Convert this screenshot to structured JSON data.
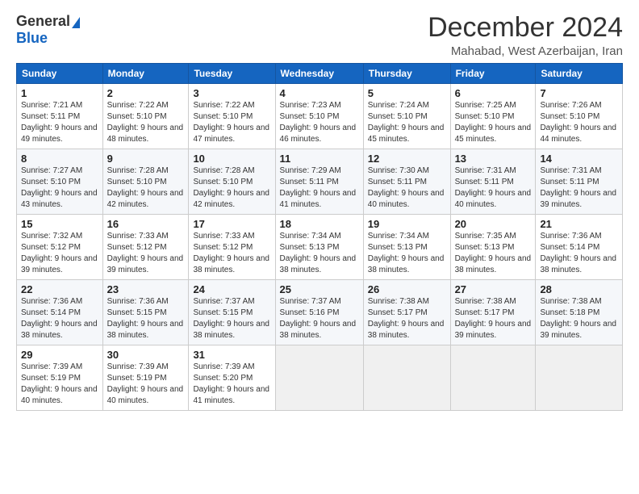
{
  "logo": {
    "general": "General",
    "blue": "Blue"
  },
  "title": "December 2024",
  "location": "Mahabad, West Azerbaijan, Iran",
  "days_header": [
    "Sunday",
    "Monday",
    "Tuesday",
    "Wednesday",
    "Thursday",
    "Friday",
    "Saturday"
  ],
  "weeks": [
    [
      {
        "day": "1",
        "sunrise": "7:21 AM",
        "sunset": "5:11 PM",
        "daylight": "9 hours and 49 minutes."
      },
      {
        "day": "2",
        "sunrise": "7:22 AM",
        "sunset": "5:10 PM",
        "daylight": "9 hours and 48 minutes."
      },
      {
        "day": "3",
        "sunrise": "7:22 AM",
        "sunset": "5:10 PM",
        "daylight": "9 hours and 47 minutes."
      },
      {
        "day": "4",
        "sunrise": "7:23 AM",
        "sunset": "5:10 PM",
        "daylight": "9 hours and 46 minutes."
      },
      {
        "day": "5",
        "sunrise": "7:24 AM",
        "sunset": "5:10 PM",
        "daylight": "9 hours and 45 minutes."
      },
      {
        "day": "6",
        "sunrise": "7:25 AM",
        "sunset": "5:10 PM",
        "daylight": "9 hours and 45 minutes."
      },
      {
        "day": "7",
        "sunrise": "7:26 AM",
        "sunset": "5:10 PM",
        "daylight": "9 hours and 44 minutes."
      }
    ],
    [
      {
        "day": "8",
        "sunrise": "7:27 AM",
        "sunset": "5:10 PM",
        "daylight": "9 hours and 43 minutes."
      },
      {
        "day": "9",
        "sunrise": "7:28 AM",
        "sunset": "5:10 PM",
        "daylight": "9 hours and 42 minutes."
      },
      {
        "day": "10",
        "sunrise": "7:28 AM",
        "sunset": "5:10 PM",
        "daylight": "9 hours and 42 minutes."
      },
      {
        "day": "11",
        "sunrise": "7:29 AM",
        "sunset": "5:11 PM",
        "daylight": "9 hours and 41 minutes."
      },
      {
        "day": "12",
        "sunrise": "7:30 AM",
        "sunset": "5:11 PM",
        "daylight": "9 hours and 40 minutes."
      },
      {
        "day": "13",
        "sunrise": "7:31 AM",
        "sunset": "5:11 PM",
        "daylight": "9 hours and 40 minutes."
      },
      {
        "day": "14",
        "sunrise": "7:31 AM",
        "sunset": "5:11 PM",
        "daylight": "9 hours and 39 minutes."
      }
    ],
    [
      {
        "day": "15",
        "sunrise": "7:32 AM",
        "sunset": "5:12 PM",
        "daylight": "9 hours and 39 minutes."
      },
      {
        "day": "16",
        "sunrise": "7:33 AM",
        "sunset": "5:12 PM",
        "daylight": "9 hours and 39 minutes."
      },
      {
        "day": "17",
        "sunrise": "7:33 AM",
        "sunset": "5:12 PM",
        "daylight": "9 hours and 38 minutes."
      },
      {
        "day": "18",
        "sunrise": "7:34 AM",
        "sunset": "5:13 PM",
        "daylight": "9 hours and 38 minutes."
      },
      {
        "day": "19",
        "sunrise": "7:34 AM",
        "sunset": "5:13 PM",
        "daylight": "9 hours and 38 minutes."
      },
      {
        "day": "20",
        "sunrise": "7:35 AM",
        "sunset": "5:13 PM",
        "daylight": "9 hours and 38 minutes."
      },
      {
        "day": "21",
        "sunrise": "7:36 AM",
        "sunset": "5:14 PM",
        "daylight": "9 hours and 38 minutes."
      }
    ],
    [
      {
        "day": "22",
        "sunrise": "7:36 AM",
        "sunset": "5:14 PM",
        "daylight": "9 hours and 38 minutes."
      },
      {
        "day": "23",
        "sunrise": "7:36 AM",
        "sunset": "5:15 PM",
        "daylight": "9 hours and 38 minutes."
      },
      {
        "day": "24",
        "sunrise": "7:37 AM",
        "sunset": "5:15 PM",
        "daylight": "9 hours and 38 minutes."
      },
      {
        "day": "25",
        "sunrise": "7:37 AM",
        "sunset": "5:16 PM",
        "daylight": "9 hours and 38 minutes."
      },
      {
        "day": "26",
        "sunrise": "7:38 AM",
        "sunset": "5:17 PM",
        "daylight": "9 hours and 38 minutes."
      },
      {
        "day": "27",
        "sunrise": "7:38 AM",
        "sunset": "5:17 PM",
        "daylight": "9 hours and 39 minutes."
      },
      {
        "day": "28",
        "sunrise": "7:38 AM",
        "sunset": "5:18 PM",
        "daylight": "9 hours and 39 minutes."
      }
    ],
    [
      {
        "day": "29",
        "sunrise": "7:39 AM",
        "sunset": "5:19 PM",
        "daylight": "9 hours and 40 minutes."
      },
      {
        "day": "30",
        "sunrise": "7:39 AM",
        "sunset": "5:19 PM",
        "daylight": "9 hours and 40 minutes."
      },
      {
        "day": "31",
        "sunrise": "7:39 AM",
        "sunset": "5:20 PM",
        "daylight": "9 hours and 41 minutes."
      },
      null,
      null,
      null,
      null
    ]
  ]
}
